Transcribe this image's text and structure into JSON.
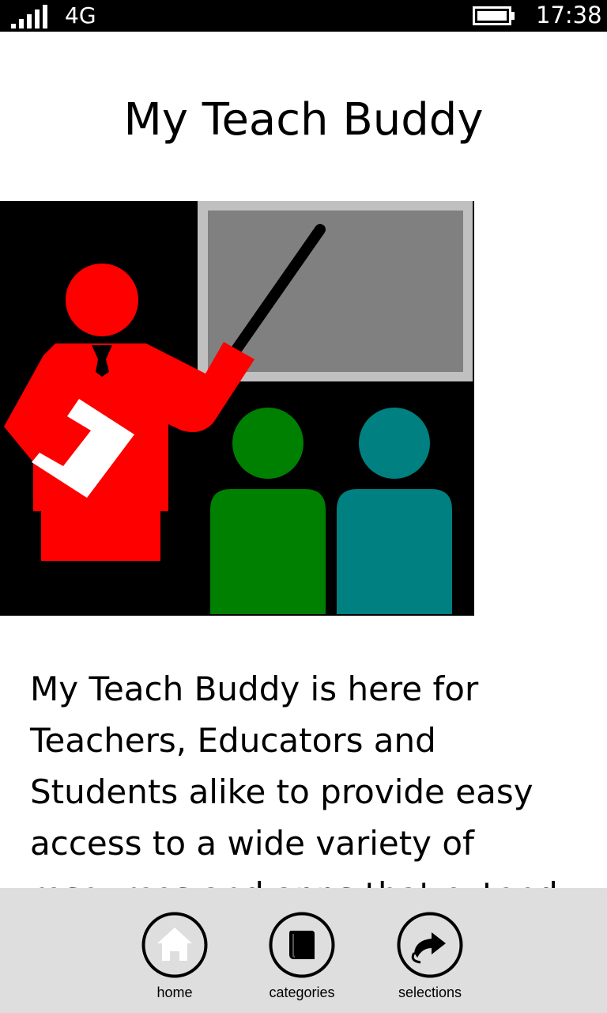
{
  "status_bar": {
    "network": "4G",
    "time": "17:38",
    "icons": [
      "signal-strength-icon",
      "battery-icon"
    ]
  },
  "page": {
    "title": "My Teach Buddy",
    "description": "My Teach Buddy is here for Teachers, Educators and Students alike to provide easy access to a wide variety of resources and apps that extend WEB"
  },
  "hero": {
    "icon": "teacher-presentation-illustration",
    "colors": {
      "background": "#000000",
      "board_frame": "#c0c0c0",
      "board": "#808080",
      "teacher": "#ff0000",
      "book": "#ffffff",
      "student_left": "#008000",
      "student_right": "#008080"
    }
  },
  "app_bar": {
    "background": "#dedede",
    "buttons": [
      {
        "label": "home",
        "icon": "home-icon"
      },
      {
        "label": "categories",
        "icon": "book-icon"
      },
      {
        "label": "selections",
        "icon": "share-arrow-icon"
      }
    ]
  }
}
